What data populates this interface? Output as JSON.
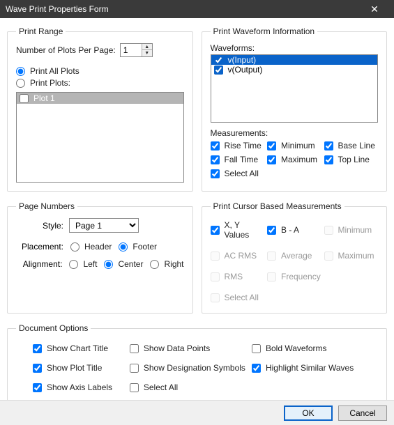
{
  "title": "Wave Print Properties Form",
  "printRange": {
    "legend": "Print Range",
    "plotsPerPageLabel": "Number of Plots Per Page:",
    "plotsPerPageValue": "1",
    "printAll": "Print All Plots",
    "printPlots": "Print Plots:",
    "plotItem": "Plot 1"
  },
  "waveInfo": {
    "legend": "Print Waveform Information",
    "wavesLabel": "Waveforms:",
    "wave1": "v(Input)",
    "wave2": "v(Output)",
    "measLabel": "Measurements:",
    "riseTime": "Rise Time",
    "fallTime": "Fall Time",
    "minimum": "Minimum",
    "maximum": "Maximum",
    "baseLine": "Base Line",
    "topLine": "Top Line",
    "selectAll": "Select All"
  },
  "pageNums": {
    "legend": "Page Numbers",
    "styleLabel": "Style:",
    "styleValue": "Page 1",
    "placementLabel": "Placement:",
    "header": "Header",
    "footer": "Footer",
    "alignLabel": "Alignment:",
    "left": "Left",
    "center": "Center",
    "right": "Right"
  },
  "cursor": {
    "legend": "Print Cursor Based Measurements",
    "xy": "X, Y Values",
    "ba": "B - A",
    "min": "Minimum",
    "acrms": "AC RMS",
    "avg": "Average",
    "max": "Maximum",
    "rms": "RMS",
    "freq": "Frequency",
    "selAll": "Select All"
  },
  "doc": {
    "legend": "Document Options",
    "chartTitle": "Show Chart Title",
    "plotTitle": "Show Plot Title",
    "axisLabels": "Show Axis Labels",
    "dataPoints": "Show Data Points",
    "desigSymbols": "Show Designation Symbols",
    "selectAll": "Select All",
    "boldWaves": "Bold Waveforms",
    "hilite": "Highlight Similar Waves"
  },
  "buttons": {
    "ok": "OK",
    "cancel": "Cancel"
  }
}
